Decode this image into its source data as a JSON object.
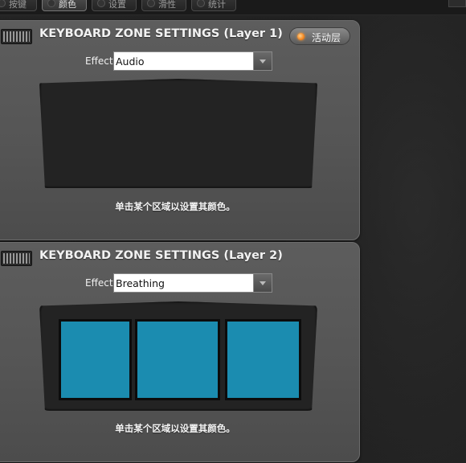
{
  "tabs": [
    {
      "label": "按键",
      "active": false
    },
    {
      "label": "颜色",
      "active": true
    },
    {
      "label": "设置",
      "active": false
    },
    {
      "label": "滑性",
      "active": false
    },
    {
      "label": "统计",
      "active": false
    }
  ],
  "active_layer_button": "活动层",
  "panels": [
    {
      "title": "KEYBOARD ZONE SETTINGS (Layer 1)",
      "effect_label": "Effect",
      "effect_value": "Audio",
      "hint": "单击某个区域以设置其颜色。",
      "zones": []
    },
    {
      "title": "KEYBOARD ZONE SETTINGS (Layer 2)",
      "effect_label": "Effect",
      "effect_value": "Breathing",
      "hint": "单击某个区域以设置其颜色。",
      "zones": [
        {
          "name": "zone-1",
          "color": "#1b8cb0"
        },
        {
          "name": "zone-2",
          "color": "#1b8cb0"
        },
        {
          "name": "zone-3",
          "color": "#1b8cb0"
        }
      ]
    }
  ],
  "colors": {
    "zone_color": "#1b8cb0",
    "led_active": "#f07a10"
  }
}
